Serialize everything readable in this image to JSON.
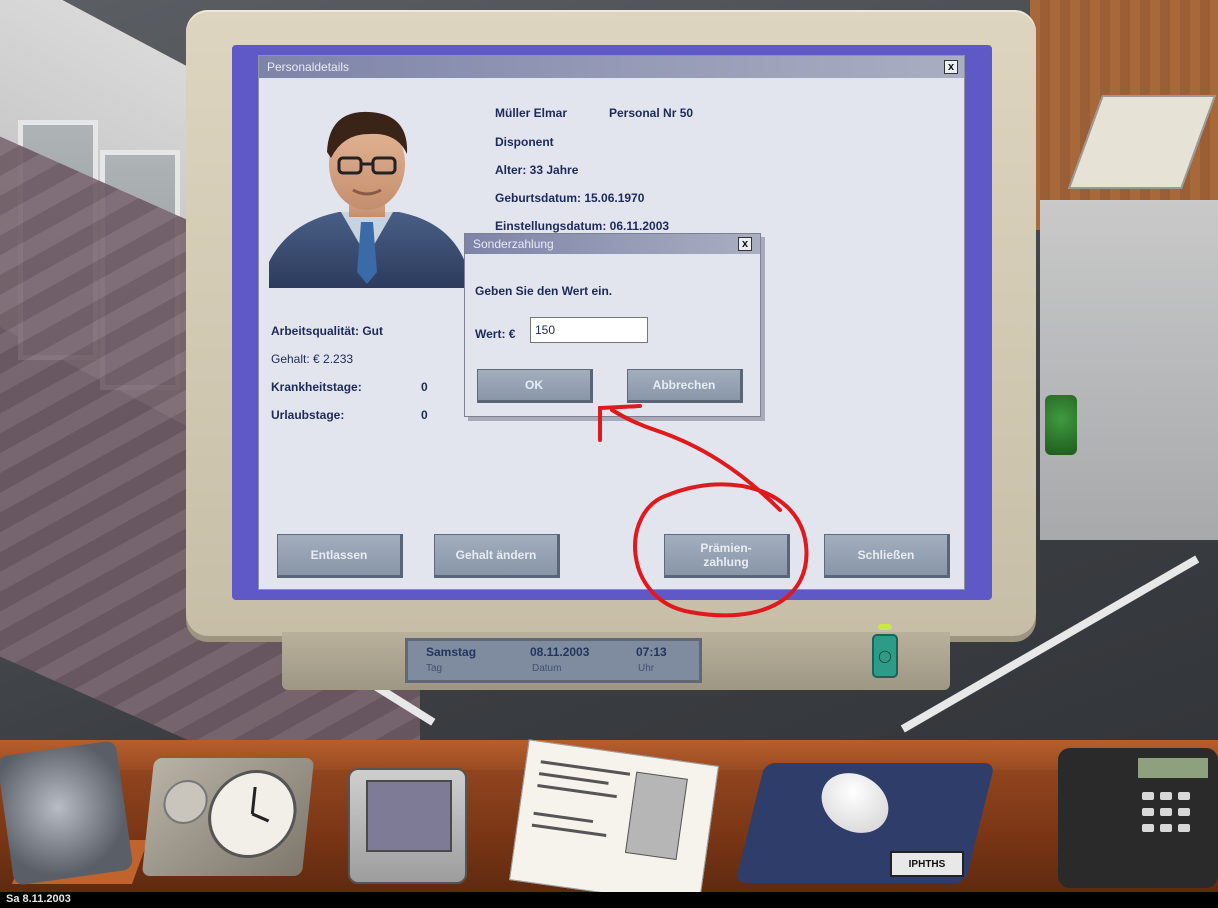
{
  "personnel_window": {
    "title": "Personaldetails",
    "close_label": "x",
    "employee": {
      "name": "Müller Elmar",
      "personnel_no": "Personal Nr 50",
      "role": "Disponent",
      "age": "Alter: 33 Jahre",
      "birthdate": "Geburtsdatum: 15.06.1970",
      "hire_date": "Einstellungsdatum: 06.11.2003"
    },
    "stats": {
      "quality_label": "Arbeitsqualität: Gut",
      "salary_label": "Gehalt: € 2.233",
      "sick_days_label": "Krankheitstage:",
      "sick_days_value": "0",
      "vacation_days_label": "Urlaubstage:",
      "vacation_days_value": "0"
    },
    "buttons": {
      "dismiss": "Entlassen",
      "change_salary": "Gehalt ändern",
      "bonus": "Prämien-\nzahlung",
      "close": "Schließen"
    }
  },
  "bonus_dialog": {
    "title": "Sonderzahlung",
    "close_label": "x",
    "prompt": "Geben Sie den Wert ein.",
    "value_label": "Wert: €",
    "value": "150",
    "ok": "OK",
    "cancel": "Abbrechen"
  },
  "monitor_display": {
    "day": "Samstag",
    "day_sub": "Tag",
    "date": "08.11.2003",
    "date_sub": "Datum",
    "time": "07:13",
    "time_sub": "Uhr"
  },
  "desk": {
    "mousepad_tag": "IPHTHS"
  },
  "status_bar": {
    "date": "Sa 8.11.2003"
  },
  "colors": {
    "annotation": "#e0191c",
    "title_bar": "#7e84a8",
    "button": "#96a2b3",
    "window_bg": "#e3e5ee"
  }
}
